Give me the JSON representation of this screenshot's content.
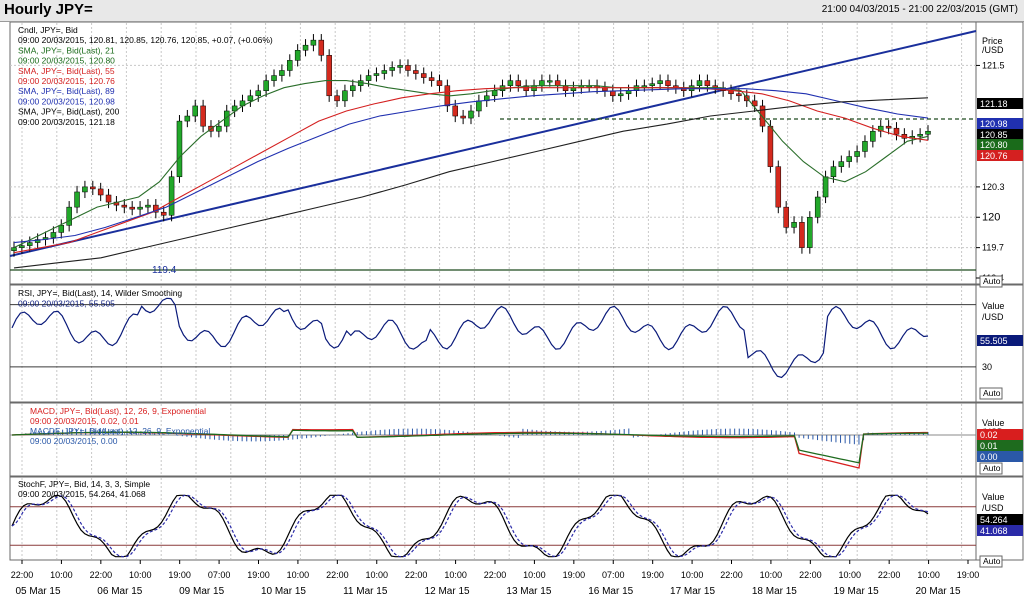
{
  "window": {
    "title": "Hourly JPY=",
    "date_range": "21:00 04/03/2015 - 21:00 22/03/2015 (GMT)"
  },
  "colors": {
    "candle_up": "#22a82a",
    "candle_down": "#d42a1e",
    "sma21": "#2a6e2a",
    "sma55": "#d42020",
    "sma89": "#2030b0",
    "sma200": "#202020",
    "trend": "#1a2f9c",
    "rsi": "#0a1a7a",
    "macd": "#d81e1e",
    "signal": "#1e6b1e",
    "hist": "#2a58a8",
    "stoch_k": "#000000",
    "stoch_d": "#2a2aa8"
  },
  "panels": {
    "price": {
      "legend": [
        {
          "text": "Cndl, JPY=, Bid",
          "color": "#000000"
        },
        {
          "text": "09:00 20/03/2015, 120.81, 120.85, 120.76, 120.85, +0.07, (+0.06%)",
          "color": "#000000"
        },
        {
          "text": "SMA, JPY=, Bid(Last), 21",
          "color": "#1a6b1a"
        },
        {
          "text": "09:00 20/03/2015, 120.80",
          "color": "#1a6b1a"
        },
        {
          "text": "SMA, JPY=, Bid(Last), 55",
          "color": "#d42020"
        },
        {
          "text": "09:00 20/03/2015, 120.76",
          "color": "#d42020"
        },
        {
          "text": "SMA, JPY=, Bid(Last), 89",
          "color": "#2030b0"
        },
        {
          "text": "09:00 20/03/2015, 120.98",
          "color": "#2030b0"
        },
        {
          "text": "SMA, JPY=, Bid(Last), 200",
          "color": "#000000"
        },
        {
          "text": "09:00 20/03/2015, 121.18",
          "color": "#000000"
        }
      ],
      "axis_unit": [
        "Price",
        "/USD"
      ],
      "ticks": [
        "121.5",
        "121.18",
        "120.98",
        "120.85",
        "120.8",
        "120.76",
        "120.3",
        "120",
        "119.7",
        "119.4"
      ],
      "badges": [
        {
          "text": "121.18",
          "bg": "#000000",
          "fg": "#ffffff"
        },
        {
          "text": "120.98",
          "bg": "#2030b0",
          "fg": "#ffffff"
        },
        {
          "text": "120.85",
          "bg": "#000000",
          "fg": "#ffffff"
        },
        {
          "text": "120.80",
          "bg": "#1a6b1a",
          "fg": "#ffffff"
        },
        {
          "text": "120.76",
          "bg": "#d42020",
          "fg": "#ffffff"
        }
      ],
      "support_label": "119.4",
      "auto": "Auto"
    },
    "rsi": {
      "legend": [
        {
          "text": "RSI, JPY=, Bid(Last), 14, Wilder Smoothing",
          "color": "#000000"
        },
        {
          "text": "09:00 20/03/2015, 55.505",
          "color": "#0a1a7a"
        }
      ],
      "axis_unit": [
        "Value",
        "/USD"
      ],
      "ticks": [
        "30"
      ],
      "badge": "55.505",
      "auto": "Auto"
    },
    "macd": {
      "legend": [
        {
          "text": "MACD, JPY=, Bid(Last), 12, 26, 9, Exponential",
          "color": "#d81e1e"
        },
        {
          "text": "09:00 20/03/2015, 0.02, 0.01",
          "color": "#d81e1e"
        },
        {
          "text": "MACDF, JPY=, Bid(Last), 12, 26, 9, Exponential",
          "color": "#2a58a8"
        },
        {
          "text": "09:00 20/03/2015, 0.00",
          "color": "#2a58a8"
        }
      ],
      "axis_unit": [
        "Value",
        "/USD"
      ],
      "badges": [
        {
          "text": "0.02",
          "bg": "#d81e1e",
          "fg": "#ffffff"
        },
        {
          "text": "0.01",
          "bg": "#1e6b1e",
          "fg": "#ffffff"
        },
        {
          "text": "0.00",
          "bg": "#2a58a8",
          "fg": "#ffffff"
        }
      ],
      "auto": "Auto"
    },
    "stoch": {
      "legend": [
        {
          "text": "StochF, JPY=, Bid, 14, 3, 3, Simple",
          "color": "#000000"
        },
        {
          "text": "09:00 20/03/2015, 54.264, 41.068",
          "color": "#000000"
        }
      ],
      "axis_unit": [
        "Value",
        "/USD"
      ],
      "badges": [
        {
          "text": "54.264",
          "bg": "#000000",
          "fg": "#ffffff"
        },
        {
          "text": "41.068",
          "bg": "#2a2aa8",
          "fg": "#ffffff"
        }
      ],
      "auto": "Auto"
    }
  },
  "time_axis": {
    "hours": [
      "22:00",
      "10:00",
      "22:00",
      "10:00",
      "19:00",
      "07:00",
      "19:00",
      "10:00",
      "22:00",
      "10:00",
      "22:00",
      "10:00",
      "22:00",
      "10:00",
      "19:00",
      "07:00",
      "19:00",
      "10:00",
      "22:00",
      "10:00",
      "22:00",
      "10:00",
      "22:00",
      "10:00",
      "19:00"
    ],
    "days": [
      "05 Mar 15",
      "06 Mar 15",
      "09 Mar 15",
      "10 Mar 15",
      "11 Mar 15",
      "12 Mar 15",
      "13 Mar 15",
      "16 Mar 15",
      "17 Mar 15",
      "18 Mar 15",
      "19 Mar 15",
      "20 Mar 15"
    ]
  },
  "chart_data": {
    "type": "line",
    "x_type": "hourly",
    "x_labels_days": [
      "05 Mar 15",
      "06 Mar 15",
      "09 Mar 15",
      "10 Mar 15",
      "11 Mar 15",
      "12 Mar 15",
      "13 Mar 15",
      "16 Mar 15",
      "17 Mar 15",
      "18 Mar 15",
      "19 Mar 15",
      "20 Mar 15"
    ],
    "ylim": [
      119.35,
      121.85
    ],
    "series": [
      {
        "name": "Cndl, JPY=, Bid",
        "values": [
          119.7,
          119.72,
          119.75,
          119.78,
          119.8,
          119.85,
          119.92,
          120.1,
          120.25,
          120.3,
          120.28,
          120.22,
          120.15,
          120.12,
          120.1,
          120.08,
          120.1,
          120.12,
          120.05,
          120.02,
          120.4,
          120.95,
          121.0,
          121.1,
          120.9,
          120.85,
          120.9,
          121.05,
          121.1,
          121.15,
          121.2,
          121.25,
          121.35,
          121.4,
          121.45,
          121.55,
          121.65,
          121.7,
          121.75,
          121.6,
          121.2,
          121.15,
          121.25,
          121.3,
          121.35,
          121.4,
          121.42,
          121.45,
          121.48,
          121.5,
          121.45,
          121.42,
          121.38,
          121.35,
          121.3,
          121.1,
          121.0,
          120.98,
          121.05,
          121.15,
          121.2,
          121.25,
          121.3,
          121.35,
          121.3,
          121.25,
          121.3,
          121.35,
          121.35,
          121.3,
          121.25,
          121.28,
          121.3,
          121.3,
          121.28,
          121.25,
          121.2,
          121.22,
          121.25,
          121.3,
          121.3,
          121.32,
          121.35,
          121.3,
          121.28,
          121.25,
          121.3,
          121.35,
          121.3,
          121.28,
          121.25,
          121.22,
          121.2,
          121.15,
          121.1,
          120.9,
          120.5,
          120.1,
          119.9,
          119.95,
          119.7,
          120.0,
          120.2,
          120.4,
          120.5,
          120.55,
          120.6,
          120.65,
          120.75,
          120.85,
          120.9,
          120.88,
          120.82,
          120.78,
          120.8,
          120.82,
          120.85
        ]
      },
      {
        "name": "SMA, JPY=, Bid(Last), 21",
        "values": [
          119.7,
          119.8,
          119.9,
          120.0,
          120.1,
          120.15,
          120.2,
          120.35,
          120.6,
          120.8,
          120.95,
          121.1,
          121.2,
          121.28,
          121.32,
          121.35,
          121.35,
          121.32,
          121.28,
          121.25,
          121.22,
          121.2,
          121.22,
          121.25,
          121.28,
          121.3,
          121.3,
          121.3,
          121.3,
          121.28,
          121.28,
          121.28,
          121.28,
          121.28,
          121.28,
          121.25,
          121.0,
          120.75,
          120.55,
          120.4,
          120.35,
          120.45,
          120.6,
          120.75,
          120.8
        ]
      },
      {
        "name": "SMA, JPY=, Bid(Last), 55",
        "values": [
          119.65,
          119.7,
          119.75,
          119.85,
          119.95,
          120.05,
          120.2,
          120.35,
          120.5,
          120.65,
          120.8,
          120.95,
          121.05,
          121.12,
          121.18,
          121.22,
          121.25,
          121.27,
          121.28,
          121.28,
          121.28,
          121.28,
          121.28,
          121.28,
          121.28,
          121.27,
          121.25,
          121.22,
          121.15,
          121.05,
          120.98,
          120.88,
          120.8,
          120.76
        ]
      },
      {
        "name": "SMA, JPY=, Bid(Last), 89",
        "values": [
          119.75,
          119.78,
          119.82,
          119.9,
          120.0,
          120.1,
          120.25,
          120.4,
          120.55,
          120.68,
          120.8,
          120.92,
          121.0,
          121.05,
          121.1,
          121.14,
          121.17,
          121.2,
          121.22,
          121.24,
          121.25,
          121.26,
          121.27,
          121.27,
          121.27,
          121.25,
          121.22,
          121.15,
          121.08,
          121.02,
          120.98
        ]
      },
      {
        "name": "SMA, JPY=, Bid(Last), 200",
        "values": [
          119.5,
          119.55,
          119.6,
          119.7,
          119.8,
          119.9,
          120.0,
          120.1,
          120.2,
          120.32,
          120.45,
          120.55,
          120.65,
          120.75,
          120.85,
          120.92,
          121.0,
          121.05,
          121.1,
          121.14,
          121.16,
          121.18
        ]
      }
    ],
    "annotations": [
      "119.4"
    ],
    "indicators": {
      "rsi_last": 55.505,
      "macd": [
        0.02,
        0.01
      ],
      "macdf": 0.0,
      "stochf": [
        54.264,
        41.068
      ]
    }
  }
}
